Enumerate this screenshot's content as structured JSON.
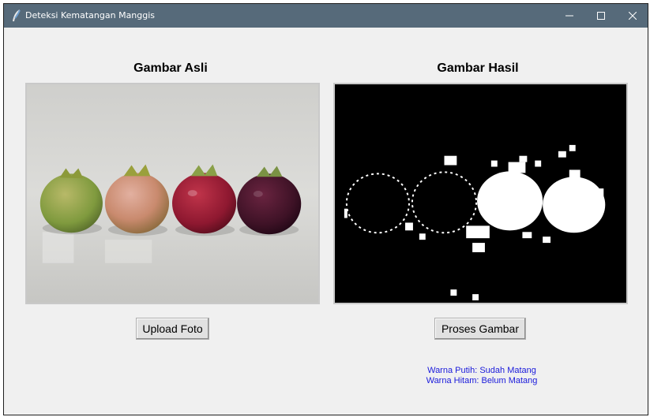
{
  "window": {
    "title": "Deteksi Kematangan Manggis",
    "controls": {
      "minimize": "minimize",
      "maximize": "maximize",
      "close": "close"
    }
  },
  "panels": {
    "left": {
      "heading": "Gambar Asli"
    },
    "right": {
      "heading": "Gambar Hasil"
    }
  },
  "buttons": {
    "upload_label": "Upload Foto",
    "process_label": "Proses Gambar"
  },
  "legend": {
    "white": "Warna Putih: Sudah Matang",
    "black": "Warna Hitam: Belum Matang"
  },
  "colors": {
    "titlebar": "#566a7a",
    "window_bg": "#f0f0f0",
    "legend_text": "#1a1adb"
  }
}
